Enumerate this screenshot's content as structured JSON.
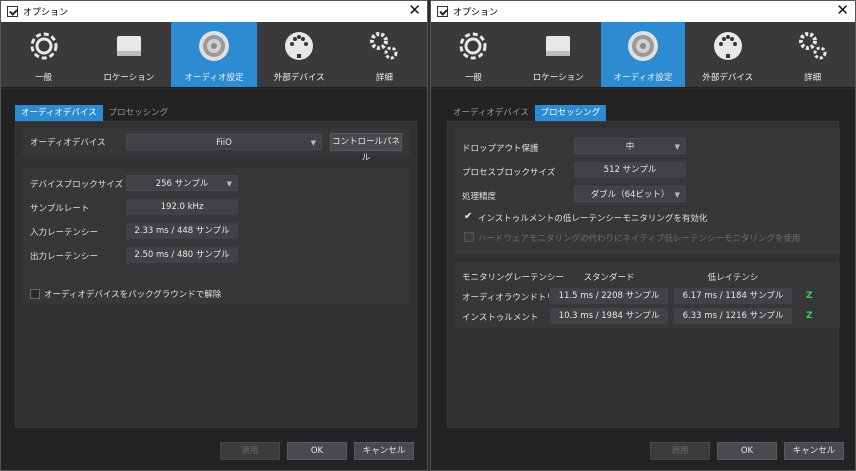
{
  "left": {
    "title": "オプション",
    "toolbar": [
      {
        "label": "一般",
        "icon": "gear-icon"
      },
      {
        "label": "ロケーション",
        "icon": "drive-icon"
      },
      {
        "label": "オーディオ設定",
        "icon": "speaker-icon",
        "active": true
      },
      {
        "label": "外部デバイス",
        "icon": "midi-icon"
      },
      {
        "label": "詳細",
        "icon": "gears-icon"
      }
    ],
    "tabs": [
      "オーディオデバイス",
      "プロセッシング"
    ],
    "active_tab": "オーディオデバイス",
    "device_label": "オーディオデバイス",
    "device_value": "FiiO",
    "control_panel": "コントロールパネル",
    "block_size_label": "デバイスブロックサイズ",
    "block_size_value": "256 サンプル",
    "sample_rate_label": "サンプルレート",
    "sample_rate_value": "192.0 kHz",
    "input_latency_label": "入力レーテンシー",
    "input_latency_value": "2.33 ms / 448 サンプル",
    "output_latency_label": "出力レーテンシー",
    "output_latency_value": "2.50 ms / 480 サンプル",
    "bg_release_label": "オーディオデバイスをバックグラウンドで解除",
    "apply": "適用",
    "ok": "OK",
    "cancel": "キャンセル"
  },
  "right": {
    "title": "オプション",
    "toolbar": [
      {
        "label": "一般",
        "icon": "gear-icon"
      },
      {
        "label": "ロケーション",
        "icon": "drive-icon"
      },
      {
        "label": "オーディオ設定",
        "icon": "speaker-icon",
        "active": true
      },
      {
        "label": "外部デバイス",
        "icon": "midi-icon"
      },
      {
        "label": "詳細",
        "icon": "gears-icon"
      }
    ],
    "tabs": [
      "オーディオデバイス",
      "プロセッシング"
    ],
    "active_tab": "プロセッシング",
    "dropout_label": "ドロップアウト保護",
    "dropout_value": "中",
    "process_block_label": "プロセスブロックサイズ",
    "process_block_value": "512 サンプル",
    "precision_label": "処理精度",
    "precision_value": "ダブル（64ビット）",
    "instrument_monitor_label": "インストゥルメントの低レーテンシーモニタリングを有効化",
    "native_monitor_label": "ハードウェアモニタリングの代わりにネイティブ低レーテンシーモニタリングを使用",
    "monitoring": {
      "header": "モニタリングレーテンシー",
      "col_standard": "スタンダード",
      "col_low": "低レイテンシ",
      "rows": [
        {
          "label": "オーディオラウンドトリップ",
          "standard": "11.5 ms / 2208 サンプル",
          "low": "6.17 ms / 1184 サンプル",
          "indicator": "Z"
        },
        {
          "label": "インストゥルメント",
          "standard": "10.3 ms / 1984 サンプル",
          "low": "6.33 ms / 1216 サンプル",
          "indicator": "Z"
        }
      ]
    },
    "apply": "適用",
    "ok": "OK",
    "cancel": "キャンセル"
  }
}
